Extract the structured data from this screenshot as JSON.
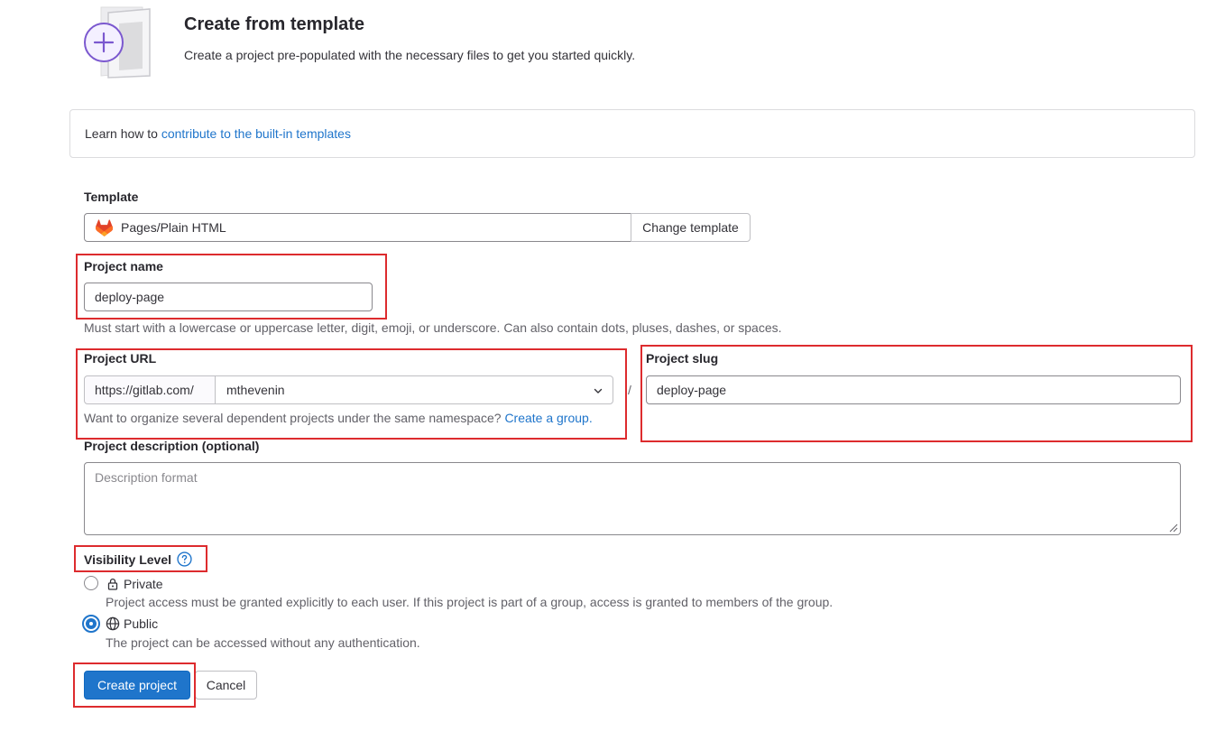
{
  "colors": {
    "accent": "#1f75cb",
    "highlight": "#dd2b2e",
    "hero_purple": "#7b58cf"
  },
  "header": {
    "title": "Create from template",
    "subtitle": "Create a project pre-populated with the necessary files to get you started quickly.",
    "illustration_icon": "plus-in-circle-document-illustration"
  },
  "info": {
    "prefix": "Learn how to",
    "link": "contribute to the built-in templates"
  },
  "template": {
    "label": "Template",
    "icon": "gitlab-tanuki-icon",
    "value": "Pages/Plain HTML",
    "change_button": "Change template"
  },
  "project_name": {
    "label": "Project name",
    "value": "deploy-page",
    "help": "Must start with a lowercase or uppercase letter, digit, emoji, or underscore. Can also contain dots, pluses, dashes, or spaces."
  },
  "project_url": {
    "label": "Project URL",
    "prefix": "https://gitlab.com/",
    "namespace": "mthevenin",
    "separator": "/",
    "help_prefix": "Want to organize several dependent projects under the same namespace?",
    "help_link": "Create a group."
  },
  "project_slug": {
    "label": "Project slug",
    "value": "deploy-page"
  },
  "description": {
    "label": "Project description (optional)",
    "placeholder": "Description format"
  },
  "visibility": {
    "label": "Visibility Level",
    "help_icon": "question-circle-icon",
    "options": [
      {
        "label": "Private",
        "icon": "lock-icon",
        "description": "Project access must be granted explicitly to each user. If this project is part of a group, access is granted to members of the group.",
        "checked": false
      },
      {
        "label": "Public",
        "icon": "globe-icon",
        "description": "The project can be accessed without any authentication.",
        "checked": true
      }
    ]
  },
  "actions": {
    "create": "Create project",
    "cancel": "Cancel"
  }
}
